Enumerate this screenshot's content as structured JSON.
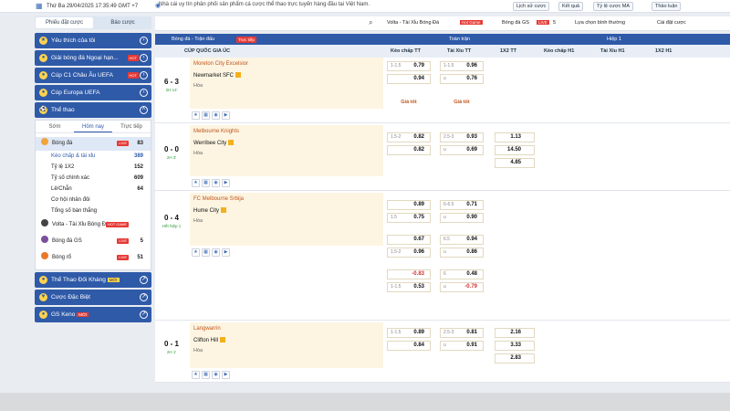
{
  "topbar": {
    "datetime": "Thứ Ba 29/04/2025 17:35:49 GMT +7",
    "announcement": "Nhà cái uy tín phân phối sản phẩm cá cược thể thao trực tuyến hàng đầu tại Việt Nam.",
    "buttons": [
      "Lịch sử cược",
      "Kết quả",
      "Tỷ lệ cược MA",
      "Thảo luận"
    ]
  },
  "left": {
    "tabs": [
      "Phiếu đặt cược",
      "Báo cược"
    ],
    "menu": [
      {
        "label": "Yêu thích của tôi"
      },
      {
        "label": "Giải bóng đá Ngoại hạn...",
        "hot": "HOT"
      },
      {
        "label": "Cúp C1 Châu Âu UEFA",
        "hot": "HOT"
      },
      {
        "label": "Cúp Europa UEFA"
      }
    ],
    "sport_title": "Thể thao",
    "subtabs": [
      "Sớm",
      "Hôm nay",
      "Trực tiếp"
    ],
    "football": {
      "label": "Bóng đá",
      "badge": "LIVE",
      "count": "83"
    },
    "subitems": [
      {
        "label": "Kèo chấp & tài xỉu",
        "count": "389"
      },
      {
        "label": "Tỷ lệ 1X2",
        "count": "152"
      },
      {
        "label": "Tỷ số chính xác",
        "count": "609"
      },
      {
        "label": "Lẻ/Chẵn",
        "count": "64"
      },
      {
        "label": "Cơ hội nhân đôi",
        "count": ""
      },
      {
        "label": "Tổng số bàn thắng",
        "count": ""
      }
    ],
    "others": [
      {
        "label": "Volta - Tài Xỉu Bóng Đá",
        "badge": "HOT GAME",
        "count": ""
      },
      {
        "label": "Bóng đá GS",
        "badge": "LIVE",
        "count": "5"
      },
      {
        "label": "Bóng rổ",
        "badge": "LIVE",
        "count": "51"
      }
    ],
    "bottom_menu": [
      {
        "label": "Thể Thao Đối Kháng",
        "tag": "MỚI"
      },
      {
        "label": "Cược Đặc Biệt",
        "tag": ""
      },
      {
        "label": "GS Keno",
        "tag": "MỚI"
      }
    ]
  },
  "filters": {
    "search": "",
    "volta": "Volta - Tài Xỉu Bóng Đá",
    "volta_badge": "Hot Game",
    "gs": "Bóng đá GS",
    "gs_badge": "LIVE",
    "gs_count": "5",
    "sort": "Lựa chọn bình thường",
    "settings": "Cài đặt cược"
  },
  "table": {
    "sport": "Bóng đá - Trận đấu",
    "live": "Trực tiếp",
    "full": "Toàn trận",
    "half": "Hiệp 1",
    "league": "CÚP QUỐC GIA ÚC",
    "cols": [
      "Kèo chấp TT",
      "Tài Xỉu TT",
      "1X2 TT",
      "Kèo chấp H1",
      "Tài Xỉu H1",
      "1X2 H1"
    ]
  },
  "matches": [
    {
      "score": "6 - 3",
      "time": "2H 14'",
      "home": "Moreton City Excelsior",
      "away": "Newmarket SFC",
      "draw": "Hòa",
      "gold": "Giá tốt",
      "rows": [
        [
          "1-1.5",
          "0.79",
          "1-1.5",
          "0.96",
          ""
        ],
        [
          "",
          "0.94",
          "u",
          "0.76",
          ""
        ]
      ]
    },
    {
      "score": "0 - 0",
      "time": "2H 3'",
      "home": "Melbourne Knights",
      "away": "Werribee City",
      "draw": "Hòa",
      "rows": [
        [
          "1.5-2",
          "0.82",
          "2.5-3",
          "0.93",
          "1.13"
        ],
        [
          "",
          "0.82",
          "u",
          "0.69",
          "14.50"
        ],
        [
          "",
          "",
          "",
          "",
          "4.85"
        ]
      ]
    },
    {
      "score": "0 - 4",
      "time": "Hết hiệp 1",
      "home": "FC Melbourne Srbija",
      "away": "Hume City",
      "draw": "Hòa",
      "rows": [
        [
          "",
          "0.89",
          "6-6.5",
          "0.71",
          ""
        ],
        [
          "1.5",
          "0.75",
          "u",
          "0.90",
          ""
        ],
        [
          "",
          "0.67",
          "6.5",
          "0.94",
          ""
        ],
        [
          "1.5-2",
          "0.96",
          "u",
          "0.86",
          ""
        ],
        [
          "",
          "-0.83",
          "6",
          "0.48",
          ""
        ],
        [
          "1-1.5",
          "0.53",
          "u",
          "-0.79",
          ""
        ]
      ]
    },
    {
      "score": "0 - 1",
      "time": "2H 1'",
      "home": "Langwarrin",
      "away": "Clifton Hill",
      "draw": "Hòa",
      "rows": [
        [
          "1-1.5",
          "0.89",
          "2.5-3",
          "0.81",
          "2.16"
        ],
        [
          "",
          "0.84",
          "u",
          "0.91",
          "3.33"
        ],
        [
          "",
          "",
          "",
          "",
          "2.83"
        ]
      ]
    }
  ]
}
